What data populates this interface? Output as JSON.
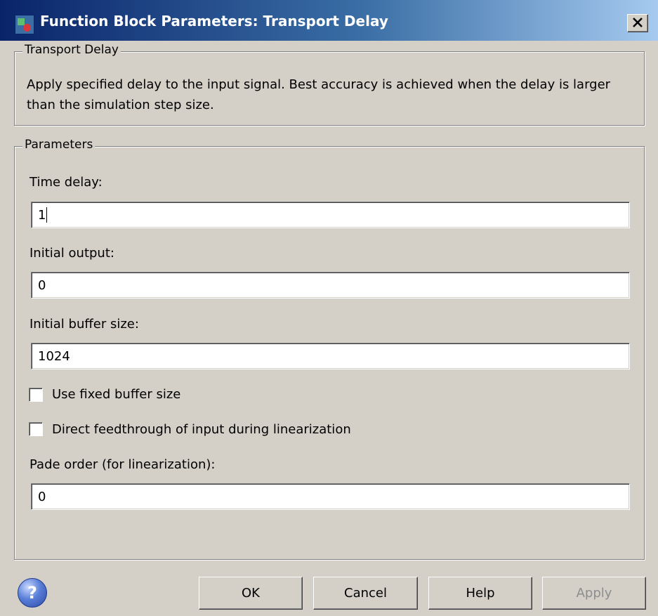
{
  "window": {
    "title": "Function Block Parameters: Transport Delay",
    "icon": "simulink-block-icon",
    "close_glyph": "✕"
  },
  "description_group": {
    "legend": "Transport Delay",
    "text": "Apply specified delay to the input signal.  Best accuracy is achieved when the delay is larger than the simulation step size."
  },
  "parameters_group": {
    "legend": "Parameters",
    "time_delay_label": "Time delay:",
    "time_delay_value": "1",
    "initial_output_label": "Initial output:",
    "initial_output_value": "0",
    "initial_buffer_label": "Initial buffer size:",
    "initial_buffer_value": "1024",
    "fixed_buffer_label": "Use fixed buffer size",
    "fixed_buffer_checked": false,
    "direct_feedthrough_label": "Direct feedthrough of input during linearization",
    "direct_feedthrough_checked": false,
    "pade_order_label": "Pade order (for linearization):",
    "pade_order_value": "0"
  },
  "buttons": {
    "help_icon_glyph": "?",
    "ok": "OK",
    "cancel": "Cancel",
    "help": "Help",
    "apply": "Apply"
  }
}
